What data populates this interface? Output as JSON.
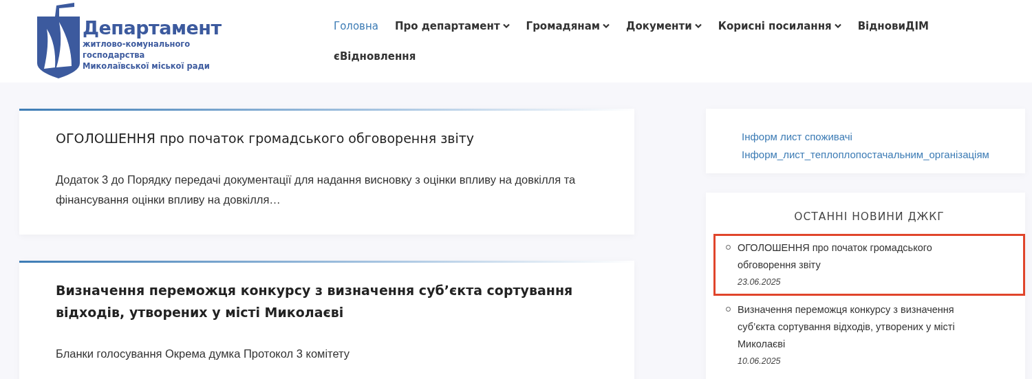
{
  "logo": {
    "title": "Департамент",
    "subtitle_lines": [
      "житлово-комунального",
      "господарства",
      "Миколаївської міської ради"
    ]
  },
  "nav": [
    {
      "label": "Головна",
      "selected": true,
      "has_menu": false
    },
    {
      "label": "Про департамент",
      "selected": false,
      "has_menu": true
    },
    {
      "label": "Громадянам",
      "selected": false,
      "has_menu": true
    },
    {
      "label": "Документи",
      "selected": false,
      "has_menu": true
    },
    {
      "label": "Корисні посилання",
      "selected": false,
      "has_menu": true
    },
    {
      "label": "ВідновиДІМ",
      "selected": false,
      "has_menu": false
    },
    {
      "label": "єВідновлення",
      "selected": false,
      "has_menu": false
    }
  ],
  "posts": [
    {
      "title": "ОГОЛОШЕННЯ про початок громадського обговорення звіту",
      "excerpt": "Додаток 3 до Порядку передачі документації для надання висновку з оцінки впливу на довкілля та фінансування оцінки впливу на довкілля…"
    },
    {
      "title": "Визначення переможця конкурсу з визначення суб’єкта сортування відходів, утворених у місті Миколаєві",
      "excerpt": "Бланки голосування Окрема думка Протокол 3 комітету"
    }
  ],
  "sidebar": {
    "links": [
      "Інформ лист споживачі",
      "Інформ_лист_теплоплопостачальним_організаціям"
    ],
    "news": {
      "title": "ОСТАННІ НОВИНИ ДЖКГ",
      "items": [
        {
          "title": "ОГОЛОШЕННЯ про початок громадського обговорення звіту",
          "date": "23.06.2025",
          "highlighted": true
        },
        {
          "title": "Визначення переможця конкурсу з визначення суб’єкта сортування відходів, утворених у місті Миколаєві",
          "date": "10.06.2025",
          "highlighted": false
        }
      ]
    }
  }
}
